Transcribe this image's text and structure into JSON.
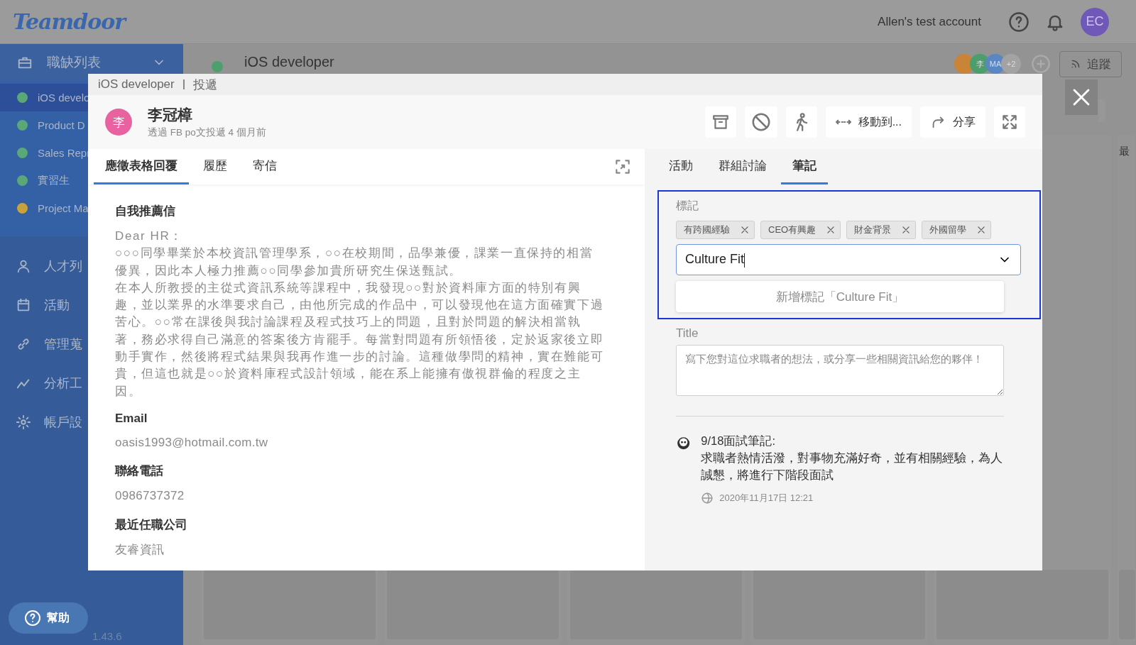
{
  "header": {
    "logo": "Teamdoor",
    "account": "Allen's test account",
    "avatar": "EC"
  },
  "sidebar": {
    "section": {
      "label": "職缺列表",
      "expanded": true
    },
    "jobs": [
      {
        "label": "iOS develo",
        "color": "#5aa877",
        "selected": true
      },
      {
        "label": "Product D",
        "color": "#5aa877",
        "selected": false
      },
      {
        "label": "Sales Repr",
        "color": "#5aa877",
        "selected": false
      },
      {
        "label": "實習生",
        "color": "#5aa877",
        "selected": false
      },
      {
        "label": "Project Ma",
        "color": "#c9a23c",
        "selected": false
      }
    ],
    "nav": [
      {
        "kind": "person",
        "label": "人才列"
      },
      {
        "kind": "calendar",
        "label": "活動"
      },
      {
        "kind": "link",
        "label": "管理蒐"
      },
      {
        "kind": "chart",
        "label": "分析工"
      },
      {
        "kind": "gear",
        "label": "帳戶設"
      }
    ],
    "help": "幫助",
    "version": "1.43.6"
  },
  "job": {
    "title": "iOS developer",
    "members": [
      {
        "color": "#c98438"
      },
      {
        "initials": "李",
        "color": "#4c9e6c"
      },
      {
        "initials": "MA",
        "color": "#5a86c4"
      },
      {
        "initials": "+2",
        "color": "#a3a3a3"
      }
    ],
    "follow": "追蹤",
    "column_header": "最"
  },
  "modal": {
    "breadcrumb": [
      "iOS developer",
      "投遞"
    ],
    "candidate": {
      "initial": "李",
      "name": "李冠樟",
      "source": "透過 FB po文投遞 4 個月前"
    },
    "actions": [
      {
        "kind": "archive"
      },
      {
        "kind": "block"
      },
      {
        "kind": "walk"
      },
      {
        "kind": "move",
        "label": "移動到..."
      },
      {
        "kind": "share",
        "label": "分享"
      },
      {
        "kind": "expand"
      }
    ],
    "left_tabs": [
      {
        "label": "應徵表格回覆",
        "selected": true
      },
      {
        "label": "履歷",
        "selected": false
      },
      {
        "label": "寄信",
        "selected": false
      }
    ],
    "form": [
      {
        "heading": "自我推薦信",
        "paragraphs": [
          "Dear HR：",
          "○○○同學畢業於本校資訊管理學系，○○在校期間，品學兼優，課業一直保持的相當優異，因此本人極力推薦○○同學參加貴所研究生保送甄試。",
          "在本人所教授的主從式資訊系統等課程中，我發現○○對於資料庫方面的特別有興趣，並以業界的水準要求自己，由他所完成的作品中，可以發現他在這方面確實下過苦心。○○常在課後與我討論課程及程式技巧上的問題，且對於問題的解決相當執著，務必求得自己滿意的答案後方肯罷手。每當對問題有所領悟後，定於返家後立即動手實作，然後將程式結果與我再作進一步的討論。這種做學問的精神，實在難能可貴，但這也就是○○於資料庫程式設計領域，能在系上能擁有傲視群倫的程度之主因。"
        ]
      },
      {
        "heading": "Email",
        "paragraphs": [
          "oasis1993@hotmail.com.tw"
        ]
      },
      {
        "heading": "聯絡電話",
        "paragraphs": [
          "0986737372"
        ]
      },
      {
        "heading": "最近任職公司",
        "paragraphs": [
          "友睿資訊"
        ]
      }
    ],
    "right_tabs": [
      {
        "label": "活動",
        "selected": false
      },
      {
        "label": "群組討論",
        "selected": false
      },
      {
        "label": "筆記",
        "selected": true
      }
    ],
    "tags": {
      "label": "標記",
      "highlighted": true,
      "items": [
        "有跨國經驗",
        "CEO有興趣",
        "財金背景",
        "外國留學"
      ],
      "input": "Culture Fit",
      "option": "新增標記「Culture Fit」"
    },
    "title_field": {
      "label": "Title",
      "placeholder": "寫下您對這位求職者的想法，或分享一些相關資訊給您的夥伴！"
    },
    "note": {
      "title": "9/18面試筆記:",
      "body": "求職者熱情活潑，對事物充滿好奇，並有相關經驗，為人誠懇，將進行下階段面試",
      "time": "2020年11月17日 12:21"
    }
  }
}
